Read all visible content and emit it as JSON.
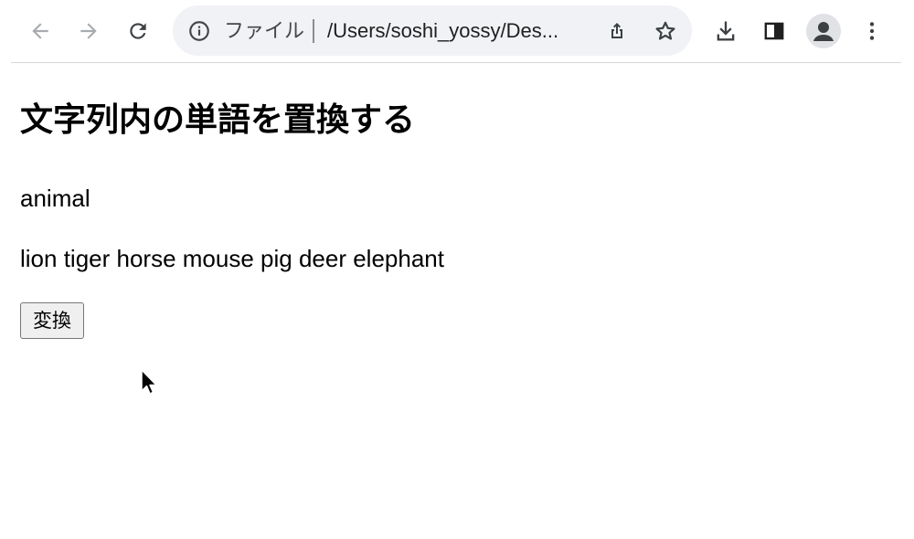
{
  "browser": {
    "omnibox": {
      "security_chip": "ファイル",
      "url": "/Users/soshi_yossy/Des..."
    },
    "icons": {
      "back": "arrow-left-icon",
      "forward": "arrow-right-icon",
      "reload": "reload-icon",
      "info": "info-icon",
      "share": "share-icon",
      "bookmark": "star-icon",
      "download": "download-icon",
      "side_panel": "side-panel-icon",
      "profile": "profile-icon",
      "menu": "kebab-menu-icon"
    }
  },
  "page": {
    "title": "文字列内の単語を置換する",
    "category_text": "animal",
    "sentence_text": "lion tiger horse mouse pig deer elephant",
    "button_label": "変換"
  },
  "colors": {
    "omnibox_bg": "#f0f2f5",
    "icon_gray": "#5f6368",
    "icon_disabled": "#a8abaf",
    "button_bg": "#efefef",
    "button_border": "#767676"
  }
}
